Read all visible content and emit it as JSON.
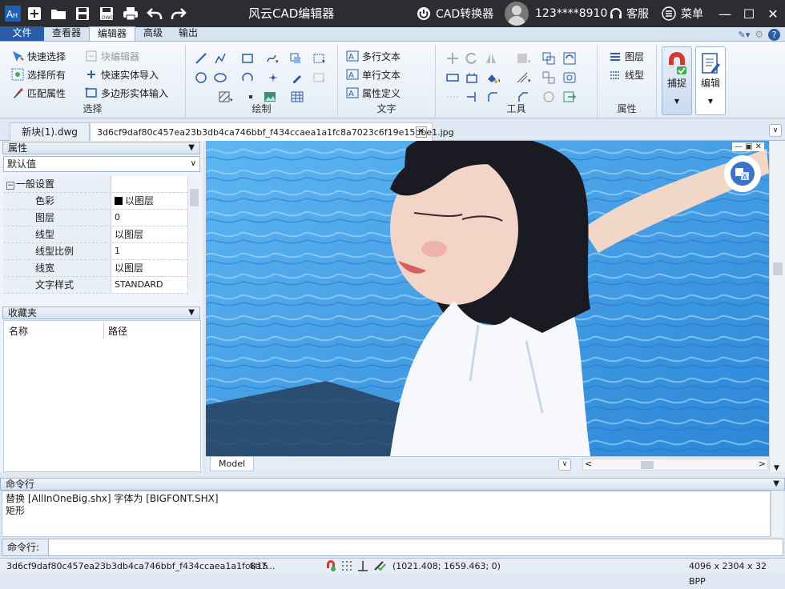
{
  "app": {
    "title": "风云CAD编辑器",
    "converter_label": "CAD转换器",
    "user_name": "123****8910",
    "service_label": "客服",
    "menu_label": "菜单"
  },
  "ribbon_tabs": [
    "文件",
    "查看器",
    "编辑器",
    "高级",
    "输出"
  ],
  "groups": {
    "select": {
      "label": "选择",
      "quick_select": "快速选择",
      "block_editor": "块编辑器",
      "select_all": "选择所有",
      "quick_entity_import": "快速实体导入",
      "match_props": "匹配属性",
      "polygon_entity_input": "多边形实体输入"
    },
    "draw": {
      "label": "绘制"
    },
    "text": {
      "label": "文字",
      "mtext": "多行文本",
      "stext": "单行文本",
      "attdef": "属性定义"
    },
    "tools": {
      "label": "工具"
    },
    "props": {
      "label": "属性",
      "layer": "图层",
      "linetype": "线型"
    },
    "snap": "捕捉",
    "edit": "编辑"
  },
  "doc_tabs": [
    "新块(1).dwg",
    "3d6cf9daf80c457ea23b3db4ca746bbf_f434ccaea1a1fc8a7023c6f19e15dbe1.jpg"
  ],
  "properties_panel": {
    "title": "属性",
    "combo_value": "默认值",
    "section": "一般设置",
    "rows": [
      {
        "key": "色彩",
        "value": "以图层"
      },
      {
        "key": "图层",
        "value": "0"
      },
      {
        "key": "线型",
        "value": "以图层"
      },
      {
        "key": "线型比例",
        "value": "1"
      },
      {
        "key": "线宽",
        "value": "以图层"
      },
      {
        "key": "文字样式",
        "value": "STANDARD"
      }
    ]
  },
  "favorites_panel": {
    "title": "收藏夹",
    "col_name": "名称",
    "col_path": "路径"
  },
  "model_tab": "Model",
  "command": {
    "title": "命令行",
    "lines": [
      "替换 [AllInOneBig.shx] 字体为 [BIGFONT.SHX]",
      "矩形"
    ],
    "input_label": "命令行:"
  },
  "status": {
    "file": "3d6cf9daf80c457ea23b3db4ca746bbf_f434ccaea1a1fc8a7...",
    "page": "4/15",
    "coords": "(1021.408; 1659.463; 0)",
    "image_info": "4096 x 2304 x 32 BPP"
  },
  "colors": {
    "titlebar": "#2b2d31",
    "accent": "#2a5ca8",
    "water": "#3a9be0"
  }
}
